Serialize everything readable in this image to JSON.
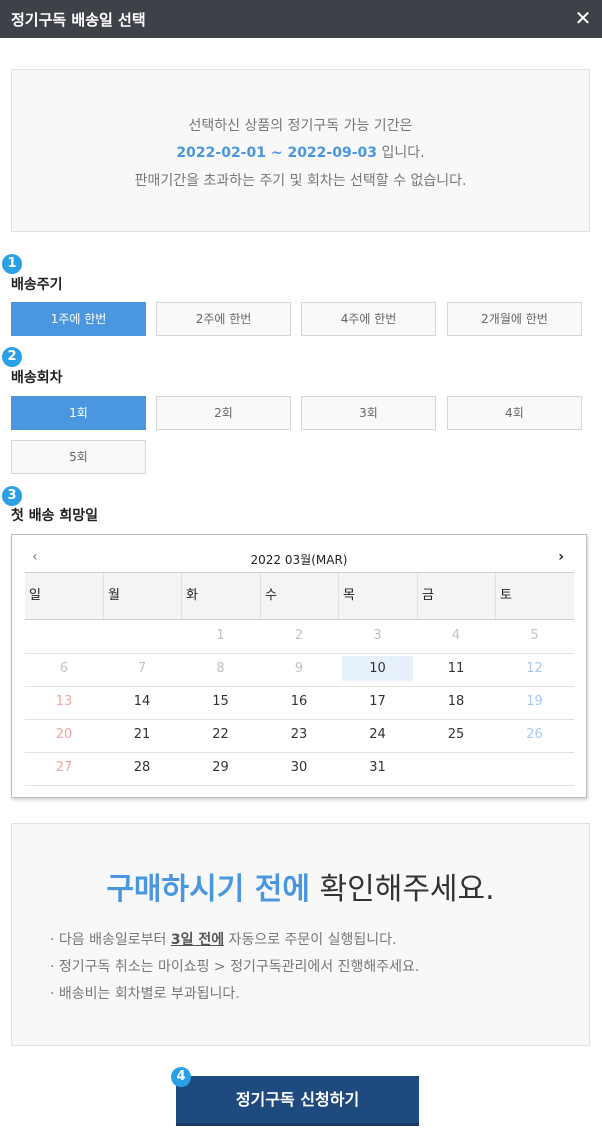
{
  "window": {
    "title": "정기구독 배송일 선택",
    "close_glyph": "✕"
  },
  "info": {
    "line1": "선택하신 상품의 정기구독 가능 기간은",
    "period": "2022-02-01 ~ 2022-09-03",
    "line2_suffix": " 입니다.",
    "line3": "판매기간을 초과하는 주기 및 회차는 선택할 수 없습니다."
  },
  "steps": {
    "s1": "1",
    "s2": "2",
    "s3": "3",
    "s4": "4",
    "badge_color": "#2aa1e6"
  },
  "cycle": {
    "label": "배송주기",
    "options": [
      "1주에 한번",
      "2주에 한번",
      "4주에 한번",
      "2개월에 한번"
    ],
    "selected": "1주에 한번"
  },
  "count": {
    "label": "배송회차",
    "options": [
      "1회",
      "2회",
      "3회",
      "4회",
      "5회"
    ],
    "selected": "1회"
  },
  "first_date": {
    "label": "첫 배송 희망일"
  },
  "calendar": {
    "prev_glyph": "‹",
    "next_glyph": "›",
    "month_label": "2022 03월(MAR)",
    "weekdays": [
      "일",
      "월",
      "화",
      "수",
      "목",
      "금",
      "토"
    ],
    "weeks": [
      [
        "",
        "",
        "1",
        "2",
        "3",
        "4",
        "5"
      ],
      [
        "6",
        "7",
        "8",
        "9",
        "10",
        "11",
        "12"
      ],
      [
        "13",
        "14",
        "15",
        "16",
        "17",
        "18",
        "19"
      ],
      [
        "20",
        "21",
        "22",
        "23",
        "24",
        "25",
        "26"
      ],
      [
        "27",
        "28",
        "29",
        "30",
        "31",
        "",
        ""
      ]
    ],
    "highlighted_day": "10",
    "first_selectable_day": 10
  },
  "notice": {
    "headline_accent": "구매하시기 전에",
    "headline_rest": " 확인해주세요.",
    "items": [
      {
        "prefix": "· 다음 배송일로부터 ",
        "emph": "3일 전에",
        "suffix": " 자동으로 주문이 실행됩니다."
      },
      {
        "text": "· 정기구독 취소는 마이쇼핑 > 정기구독관리에서 진행해주세요."
      },
      {
        "text": "· 배송비는 회차별로 부과됩니다."
      }
    ]
  },
  "submit": {
    "label": "정기구독 신청하기"
  },
  "colors": {
    "accent": "#4a97e0",
    "titlebar": "#3e4147",
    "button": "#1f4a80"
  }
}
